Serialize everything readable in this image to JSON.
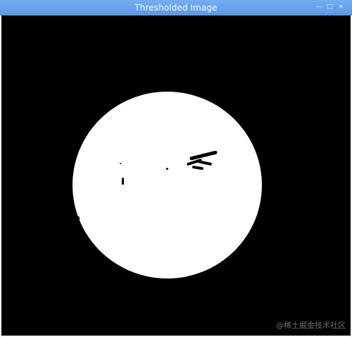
{
  "window": {
    "title": "Thresholded Image",
    "controls": {
      "minimize": "—",
      "maximize": "□",
      "close": "×"
    }
  },
  "image": {
    "watermark": "@稀土掘金技术社区"
  },
  "colors": {
    "titlebar": "#5a97e6",
    "background": "#000000",
    "foreground": "#ffffff"
  }
}
